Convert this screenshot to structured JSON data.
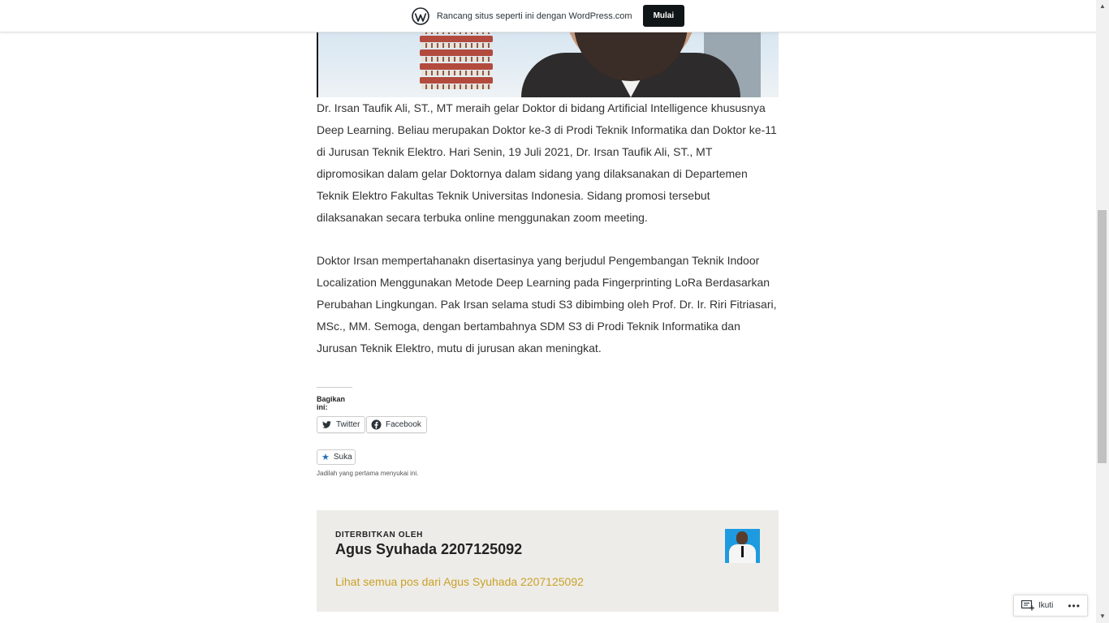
{
  "wpbar": {
    "text": "Rancang situs seperti ini dengan WordPress.com",
    "button": "Mulai"
  },
  "article": {
    "paragraphs": [
      "Dr. Irsan Taufik Ali, ST., MT meraih gelar Doktor di bidang Artificial Intelligence khususnya Deep Learning. Beliau merupakan Doktor ke-3 di Prodi Teknik Informatika dan Doktor ke-11 di Jurusan Teknik Elektro. Hari Senin, 19 Juli 2021, Dr. Irsan Taufik Ali, ST., MT dipromosikan dalam gelar Doktornya dalam sidang yang dilaksanakan di Departemen Teknik Elektro Fakultas Teknik Universitas Indonesia. Sidang promosi tersebut dilaksanakan secara terbuka online menggunakan zoom meeting.",
      "Doktor Irsan mempertahanakn disertasinya yang berjudul Pengembangan Teknik Indoor Localization Menggunakan Metode Deep Learning pada Fingerprinting LoRa Berdasarkan Perubahan Lingkungan. Pak Irsan selama studi S3 dibimbing oleh Prof. Dr. Ir. Riri Fitriasari, MSc., MM. Semoga, dengan bertambahnya SDM S3 di Prodi Teknik Informatika dan Jurusan Teknik Elektro, mutu di jurusan akan meningkat."
    ]
  },
  "share": {
    "heading": "Bagikan ini:",
    "twitter": "Twitter",
    "facebook": "Facebook"
  },
  "like": {
    "label": "Suka",
    "note": "Jadilah yang pertama menyukai ini."
  },
  "author": {
    "label": "DITERBITKAN OLEH",
    "name": "Agus Syuhada 2207125092",
    "link": "Lihat semua pos dari Agus Syuhada 2207125092"
  },
  "follow": {
    "label": "Ikuti",
    "more": "•••"
  }
}
